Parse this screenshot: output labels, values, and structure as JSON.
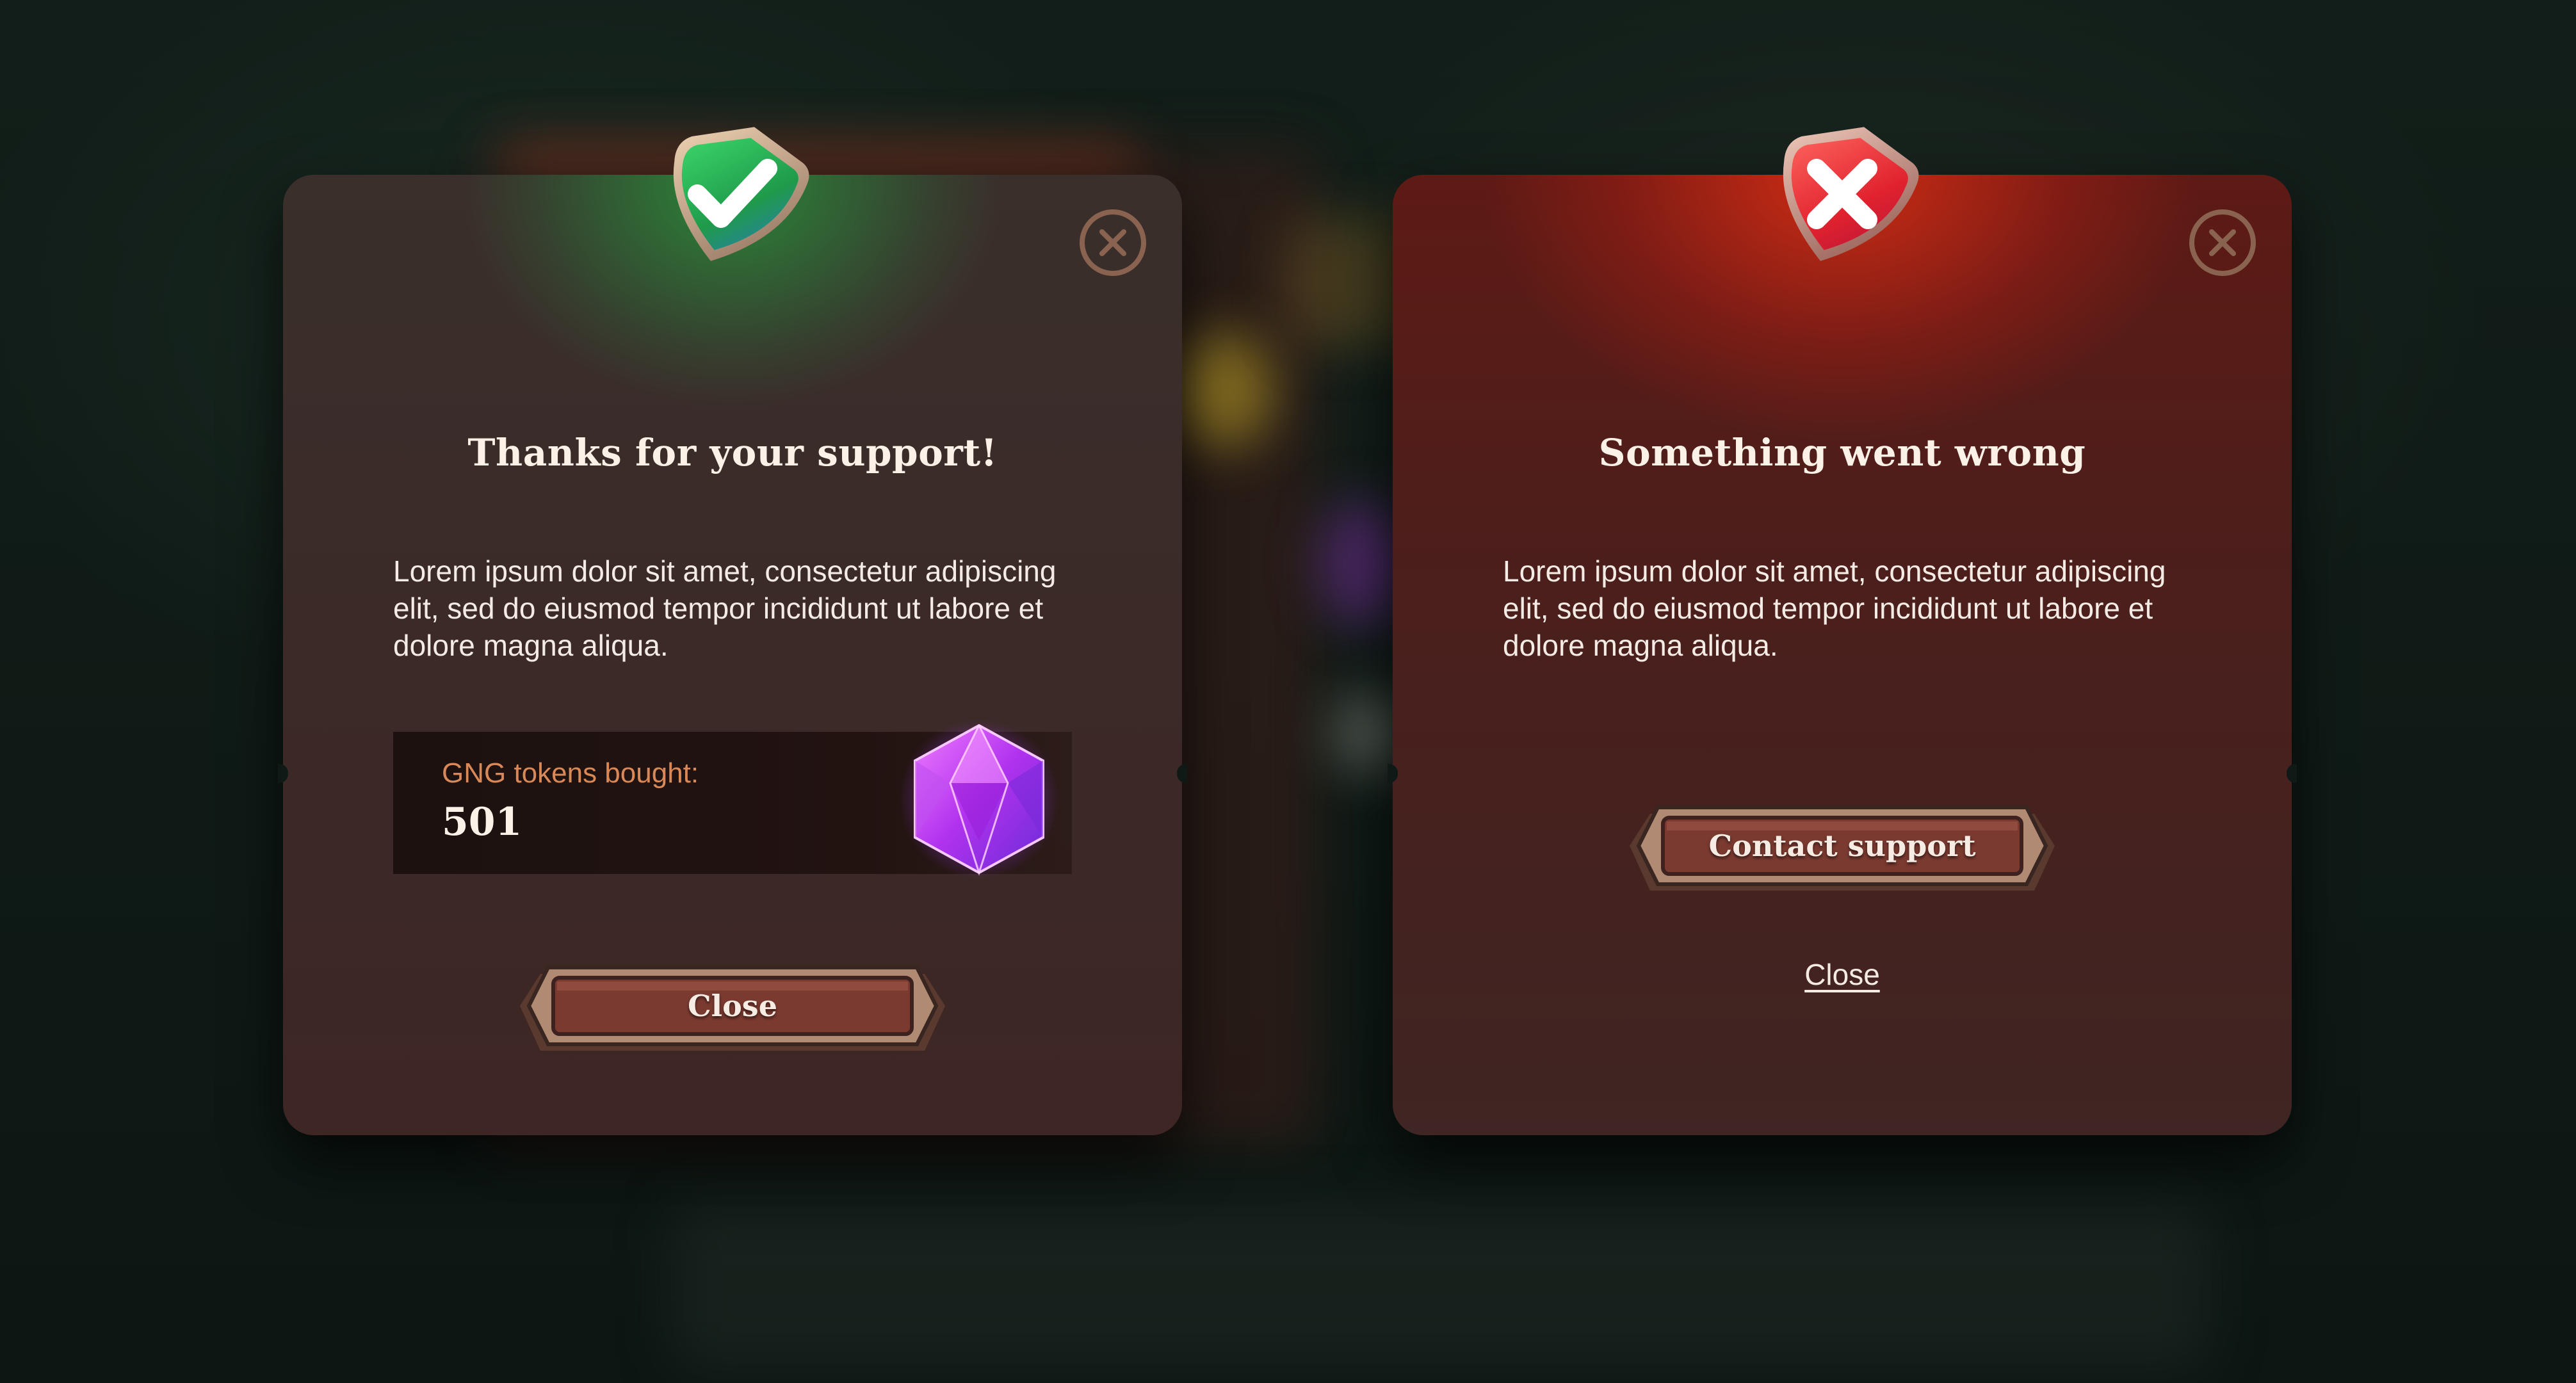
{
  "success_modal": {
    "title": "Thanks for your support!",
    "body": "Lorem ipsum dolor sit amet, consectetur adipiscing elit, sed do eiusmod tempor incididunt ut labore et dolore magna aliqua.",
    "tokens_label": "GNG tokens bought:",
    "tokens_value": "501",
    "close_button_label": "Close",
    "badge_icon": "check-shield-icon",
    "gem_icon": "gem-icon",
    "accent_color": "#2fb85a"
  },
  "error_modal": {
    "title": "Something went wrong",
    "body": "Lorem ipsum dolor sit amet, consectetur adipiscing elit, sed do eiusmod tempor incididunt ut labore et dolore magna aliqua.",
    "contact_button_label": "Contact support",
    "close_link_label": "Close",
    "badge_icon": "x-shield-icon",
    "accent_color": "#e23a36"
  },
  "close_icon": "close-icon"
}
